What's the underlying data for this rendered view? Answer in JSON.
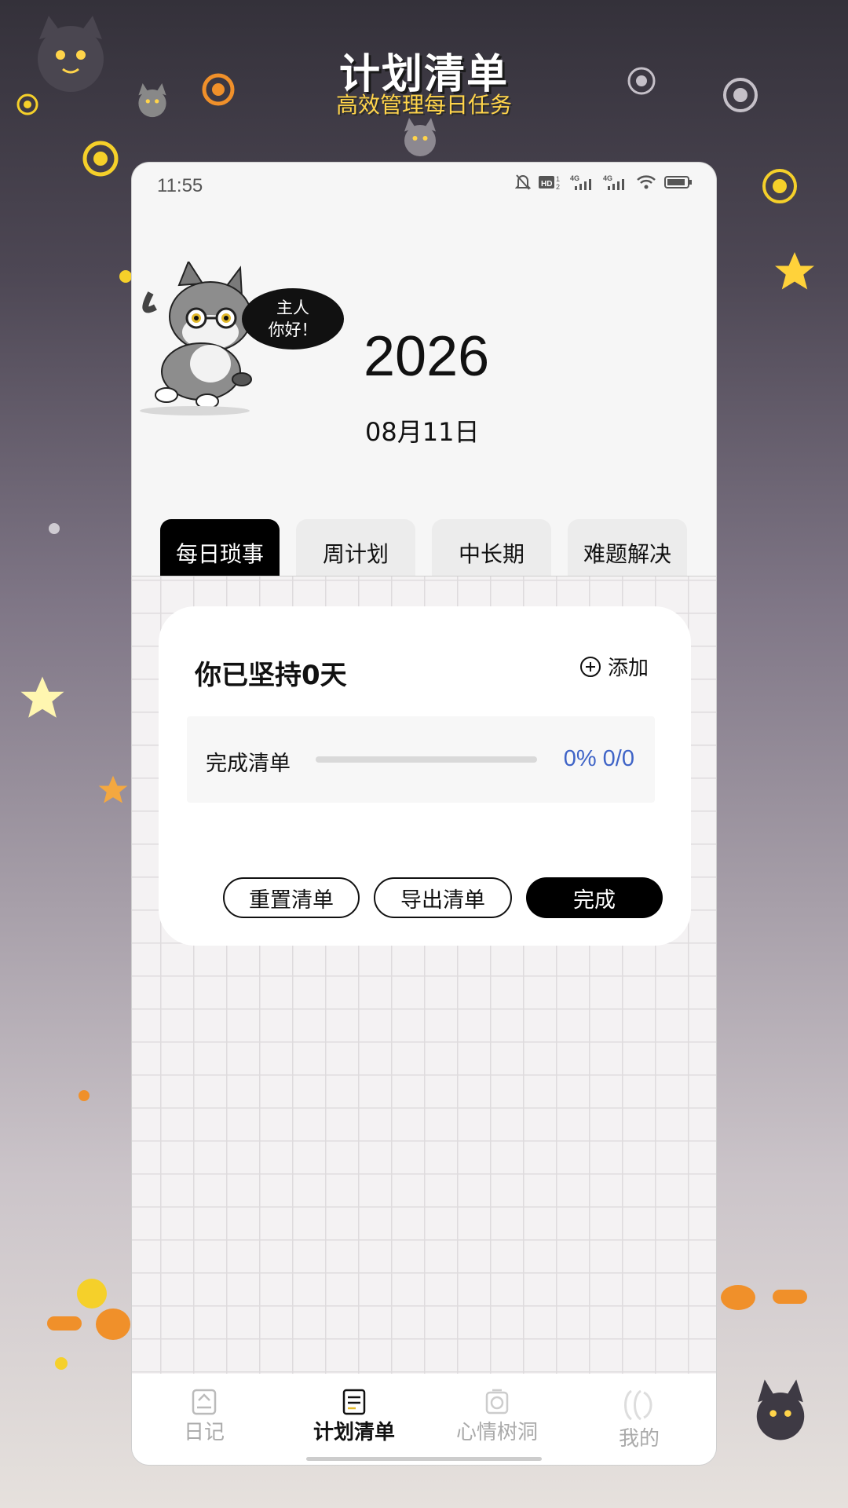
{
  "hero": {
    "title": "计划清单",
    "subtitle": "高效管理每日任务"
  },
  "status_bar": {
    "time": "11:55",
    "icons": [
      "bell-off-icon",
      "hd-icon",
      "signal-4g-icon",
      "signal-4g-icon",
      "wifi-icon",
      "battery-icon"
    ]
  },
  "header": {
    "bubble_line1": "主人",
    "bubble_line2": "你好！",
    "year": "2026",
    "date": "08月11日"
  },
  "tabs": [
    {
      "label": "每日琐事",
      "active": true
    },
    {
      "label": "周计划",
      "active": false
    },
    {
      "label": "中长期",
      "active": false
    },
    {
      "label": "难题解决",
      "active": false
    }
  ],
  "card": {
    "streak": "你已坚持0天",
    "add_label": "添加",
    "progress_label": "完成清单",
    "progress_value": "0% 0/0",
    "progress_fraction": 0,
    "reset_label": "重置清单",
    "export_label": "导出清单",
    "done_label": "完成"
  },
  "nav": [
    {
      "label": "日记",
      "icon": "diary-icon",
      "active": false
    },
    {
      "label": "计划清单",
      "icon": "checklist-icon",
      "active": true
    },
    {
      "label": "心情树洞",
      "icon": "mood-icon",
      "active": false
    },
    {
      "label": "我的",
      "icon": "profile-icon",
      "active": false
    }
  ],
  "colors": {
    "accent": "#3f64c7",
    "active_tab": "#000000",
    "hero_subtitle": "#ffd44a"
  }
}
